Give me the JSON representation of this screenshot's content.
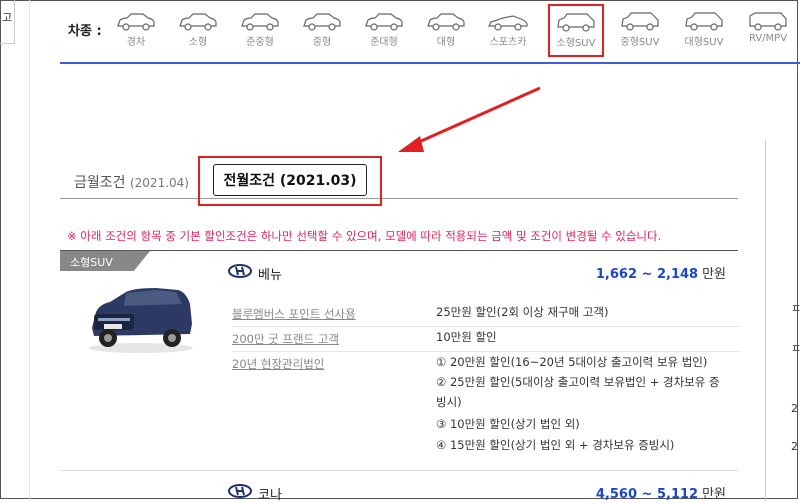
{
  "left_stub_text": "고",
  "cartype": {
    "label": "차종 :",
    "items": [
      {
        "label": "경차",
        "icon": "compact-car-icon"
      },
      {
        "label": "소형",
        "icon": "small-car-icon"
      },
      {
        "label": "준중형",
        "icon": "semi-midsize-car-icon"
      },
      {
        "label": "중형",
        "icon": "midsize-car-icon"
      },
      {
        "label": "준대형",
        "icon": "semi-large-car-icon"
      },
      {
        "label": "대형",
        "icon": "large-car-icon"
      },
      {
        "label": "스포츠카",
        "icon": "sports-car-icon"
      },
      {
        "label": "소형SUV",
        "icon": "small-suv-icon",
        "selected": true
      },
      {
        "label": "중형SUV",
        "icon": "midsize-suv-icon"
      },
      {
        "label": "대형SUV",
        "icon": "large-suv-icon"
      },
      {
        "label": "RV/MPV",
        "icon": "rv-mpv-icon"
      }
    ]
  },
  "tabs": {
    "prev_label": "금월조건",
    "prev_date": "(2021.04)",
    "active_label": "전월조건 (2021.03)"
  },
  "notice": "※ 아래 조건의 항목 중 기본 할인조건은 하나만 선택할 수 있으며, 모델에 따라 적용되는 금액 및 조건이 변경될 수 있습니다.",
  "category_badge": "소형SUV",
  "models": [
    {
      "name": "베뉴",
      "price": "1,662 ~ 2,148",
      "unit": "만원",
      "conditions": [
        {
          "label": "블루멤버스 포인트 선사용",
          "lines": [
            "25만원 할인(2회 이상 재구매 고객)"
          ]
        },
        {
          "label": "200만 굿 프랜드 고객",
          "lines": [
            "10만원 할인"
          ]
        },
        {
          "label": "20년 현장관리법인",
          "lines": [
            "① 20만원 할인(16~20년 5대이상 출고이력 보유 법인)",
            "② 25만원 할인(5대이상 출고이력 보유법인 + 경차보유 증",
            "빙시)",
            "③ 10만원 할인(상기 법인 외)",
            "④ 15만원 할인(상기 법인 외 + 경차보유 증빙시)"
          ]
        }
      ]
    },
    {
      "name": "코나",
      "price": "4,560 ~ 5,112",
      "unit": "만원"
    }
  ],
  "colors": {
    "accent_blue": "#3c5ed6",
    "price_blue": "#1a47c6",
    "highlight_red": "#e32020",
    "notice_pink": "#e0245e"
  },
  "right_panel_glyphs": [
    "ㅍ",
    "ㅍ",
    "2",
    "2"
  ]
}
